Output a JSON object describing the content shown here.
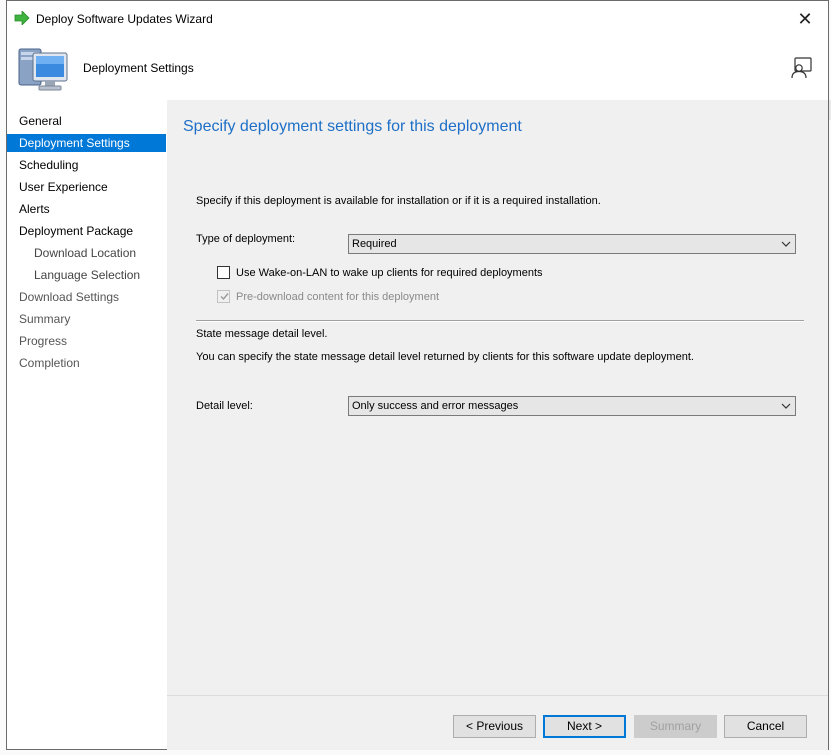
{
  "window": {
    "title": "Deploy Software Updates Wizard",
    "close_glyph": "✕"
  },
  "header": {
    "title": "Deployment Settings",
    "icon": "computer-icon",
    "help_icon": "help-person-icon"
  },
  "nav": {
    "items": [
      {
        "label": "General",
        "state": "normal"
      },
      {
        "label": "Deployment Settings",
        "state": "active"
      },
      {
        "label": "Scheduling",
        "state": "normal"
      },
      {
        "label": "User Experience",
        "state": "normal"
      },
      {
        "label": "Alerts",
        "state": "normal"
      },
      {
        "label": "Deployment Package",
        "state": "normal"
      },
      {
        "label": "Download Location",
        "state": "sub"
      },
      {
        "label": "Language Selection",
        "state": "sub"
      },
      {
        "label": "Download Settings",
        "state": "dim"
      },
      {
        "label": "Summary",
        "state": "dim"
      },
      {
        "label": "Progress",
        "state": "dim"
      },
      {
        "label": "Completion",
        "state": "dim"
      }
    ]
  },
  "content": {
    "heading": "Specify deployment settings for this deployment",
    "intro": "Specify if this deployment is available for installation or if it is a required installation.",
    "type_label": "Type of deployment:",
    "type_value": "Required",
    "wol_label": "Use Wake-on-LAN to wake up clients for required deployments",
    "wol_checked": false,
    "predownload_label": "Pre-download content for this deployment",
    "predownload_checked": true,
    "predownload_enabled": false,
    "state_title": "State message detail level.",
    "state_desc": "You can specify the state message detail level returned by clients for this software update deployment.",
    "detail_label": "Detail level:",
    "detail_value": "Only success and error messages"
  },
  "footer": {
    "previous": "< Previous",
    "next": "Next >",
    "summary": "Summary",
    "cancel": "Cancel"
  },
  "colors": {
    "accent": "#0078d7",
    "heading": "#1e6fc7"
  }
}
